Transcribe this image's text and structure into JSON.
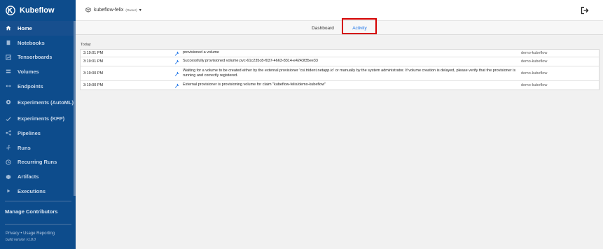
{
  "app": {
    "name": "Kubeflow",
    "build": "build version v1.8.0"
  },
  "sidebar": {
    "items": [
      {
        "label": "Home",
        "icon": "home-icon",
        "active": true
      },
      {
        "label": "Notebooks",
        "icon": "book-icon"
      },
      {
        "label": "Tensorboards",
        "icon": "chart-icon"
      },
      {
        "label": "Volumes",
        "icon": "storage-icon"
      },
      {
        "label": "Endpoints",
        "icon": "arrows-icon"
      },
      {
        "label": "Experiments (AutoML)",
        "icon": "automl-icon"
      },
      {
        "label": "Experiments (KFP)",
        "icon": "check-icon"
      },
      {
        "label": "Pipelines",
        "icon": "share-icon"
      },
      {
        "label": "Runs",
        "icon": "run-icon"
      },
      {
        "label": "Recurring Runs",
        "icon": "clock-icon"
      },
      {
        "label": "Artifacts",
        "icon": "artifact-icon"
      },
      {
        "label": "Executions",
        "icon": "play-icon"
      }
    ],
    "manage_contributors": "Manage Contributors",
    "privacy": "Privacy",
    "separator": " • ",
    "usage_reporting": "Usage Reporting"
  },
  "topbar": {
    "namespace": "kubeflow-felix",
    "role": "(Owner)"
  },
  "tabs": {
    "dashboard": "Dashboard",
    "activity": "Activity",
    "active": "activity",
    "highlight_color": "#d40000"
  },
  "activity": {
    "group_label": "Today",
    "rows": [
      {
        "time": "3:19:01 PM",
        "message": "provisioned a volume",
        "namespace": "demo-kubeflow"
      },
      {
        "time": "3:19:01 PM",
        "message": "Successfully provisioned volume pvc-61c235c8-f037-4663-8314-e4243f35ee33",
        "namespace": "demo-kubeflow"
      },
      {
        "time": "3:19:00 PM",
        "message": "Waiting for a volume to be created either by the external provisioner 'csi.trident.netapp.io' or manually by the system administrator. If volume creation is delayed, please verify that the provisioner is running and correctly registered.",
        "namespace": "demo-kubeflow"
      },
      {
        "time": "3:19:00 PM",
        "message": "External provisioner is provisioning volume for claim \"kubeflow-felix/demo-kubeflow\"",
        "namespace": "demo-kubeflow"
      }
    ]
  },
  "colors": {
    "sidebar": "#0d4c8c",
    "accent": "#1a73e8",
    "wrench_icon": "#1a73e8"
  }
}
